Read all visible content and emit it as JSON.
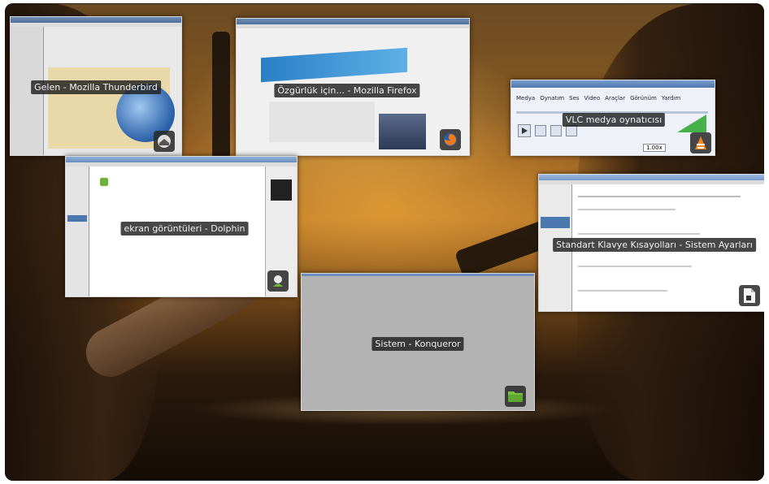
{
  "windows": [
    {
      "id": "thunderbird",
      "caption": "Gelen - Mozilla Thunderbird",
      "icon": "thunderbird-icon"
    },
    {
      "id": "firefox",
      "caption": "Özgürlük için... - Mozilla Firefox",
      "icon": "firefox-icon"
    },
    {
      "id": "vlc",
      "caption": "VLC medya oynatıcısı",
      "icon": "vlc-icon",
      "menu": [
        "Medya",
        "Oynatım",
        "Ses",
        "Video",
        "Araçlar",
        "Görünüm",
        "Yardım"
      ],
      "time": "1.00x"
    },
    {
      "id": "dolphin",
      "caption": "ekran görüntüleri - Dolphin",
      "icon": "dolphin-icon"
    },
    {
      "id": "systemsettings",
      "caption": "Standart Klavye Kısayolları - Sistem Ayarları",
      "icon": "system-settings-icon"
    },
    {
      "id": "konqueror",
      "caption": "Sistem - Konqueror",
      "icon": "konqueror-folder-icon"
    }
  ],
  "colors": {
    "accent": "#4c78b0",
    "label_bg": "#1e1e1e",
    "vlc_orange": "#f08a1c"
  }
}
